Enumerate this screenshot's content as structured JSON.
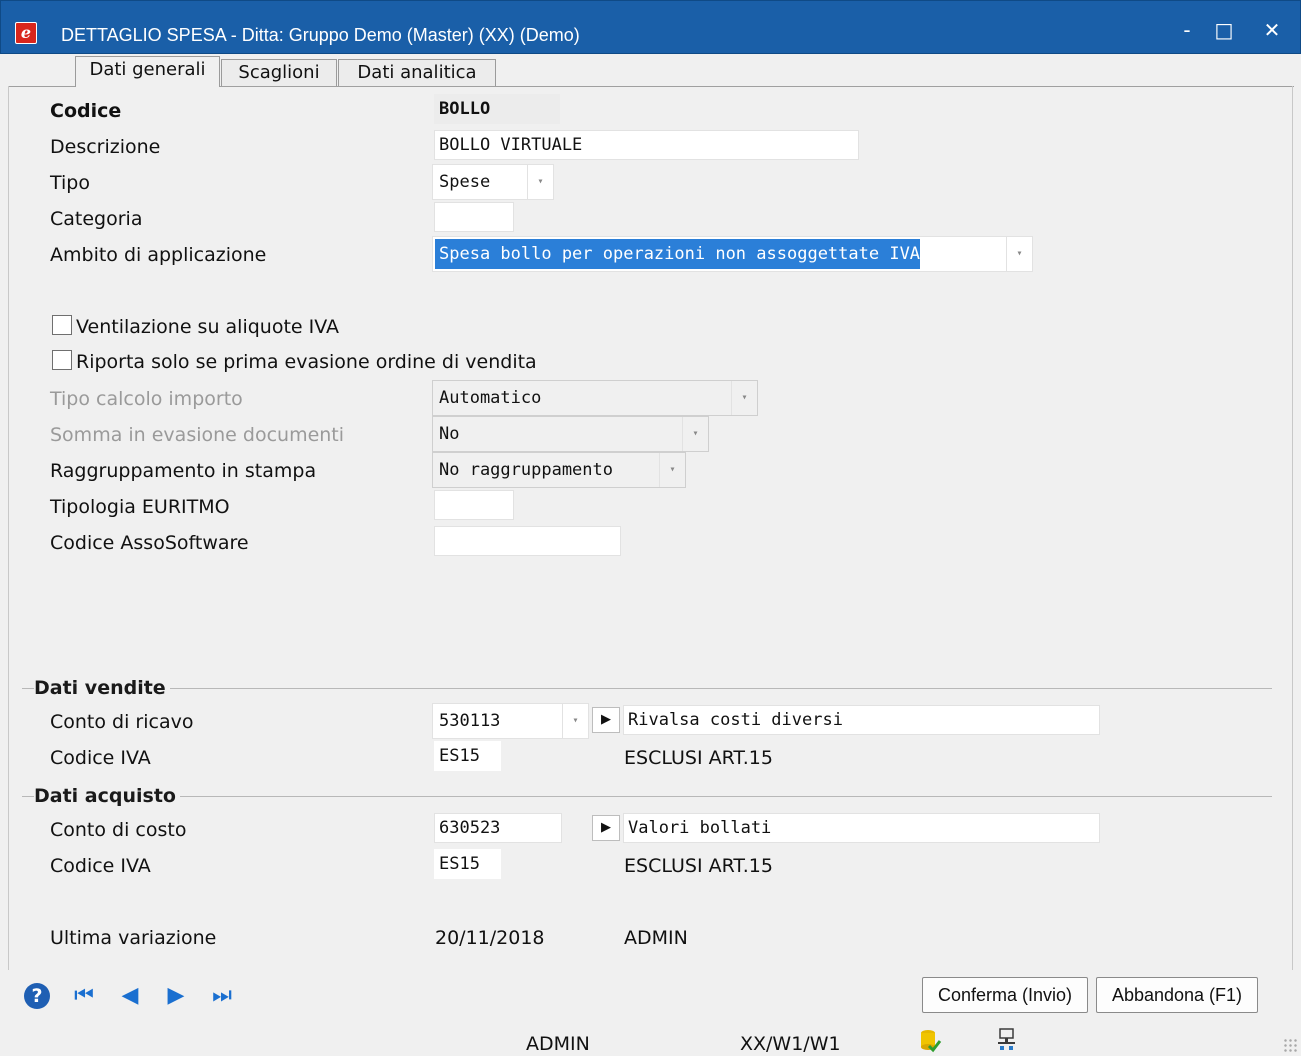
{
  "window": {
    "title": "DETTAGLIO SPESA - Ditta: Gruppo Demo (Master) (XX)  (Demo)",
    "app_icon_glyph": "e",
    "minimize": "-",
    "maximize": "□",
    "close": "✕"
  },
  "tabs": [
    {
      "label": "Dati generali",
      "active": true
    },
    {
      "label": "Scaglioni",
      "active": false
    },
    {
      "label": "Dati analitica",
      "active": false
    }
  ],
  "form": {
    "codice": {
      "label": "Codice",
      "value": "BOLLO"
    },
    "descrizione": {
      "label": "Descrizione",
      "value": "BOLLO VIRTUALE"
    },
    "tipo": {
      "label": "Tipo",
      "value": "Spese"
    },
    "categoria": {
      "label": "Categoria",
      "value": ""
    },
    "ambito": {
      "label": "Ambito di applicazione",
      "value": "Spesa bollo per operazioni non assoggettate IVA"
    },
    "ventilazione": {
      "label": "Ventilazione su aliquote IVA",
      "checked": false
    },
    "riporta": {
      "label": "Riporta solo se prima evasione ordine di vendita",
      "checked": false
    },
    "tipo_calcolo": {
      "label": "Tipo calcolo importo",
      "value": "Automatico"
    },
    "somma_evasione": {
      "label": "Somma in evasione documenti",
      "value": "No"
    },
    "raggruppamento": {
      "label": "Raggruppamento in stampa",
      "value": "No raggruppamento"
    },
    "tipologia_euritmo": {
      "label": "Tipologia EURITMO",
      "value": ""
    },
    "codice_assosoftware": {
      "label": "Codice AssoSoftware",
      "value": ""
    }
  },
  "vendite": {
    "section_title": "Dati vendite",
    "conto_label": "Conto di ricavo",
    "conto_value": "530113",
    "conto_desc": "Rivalsa costi diversi",
    "iva_label": "Codice IVA",
    "iva_value": "ES15",
    "iva_desc": "ESCLUSI ART.15"
  },
  "acquisto": {
    "section_title": "Dati acquisto",
    "conto_label": "Conto di costo",
    "conto_value": "630523",
    "conto_desc": "Valori bollati",
    "iva_label": "Codice IVA",
    "iva_value": "ES15",
    "iva_desc": "ESCLUSI ART.15"
  },
  "ultima_variazione": {
    "label": "Ultima variazione",
    "date": "20/11/2018",
    "user": "ADMIN"
  },
  "toolbar": {
    "help_glyph": "?",
    "first_glyph": "⏮",
    "prev_glyph": "◀",
    "next_glyph": "▶",
    "last_glyph": "⏭",
    "confirm_label": "Conferma (Invio)",
    "cancel_label": "Abbandona (F1)"
  },
  "statusbar": {
    "user": "ADMIN",
    "path": "XX/W1/W1"
  },
  "icons": {
    "dropdown_arrow": "▾",
    "goto_arrow": "▶"
  },
  "colors": {
    "titlebar": "#1a5fa8",
    "selection": "#2b7fd8",
    "nav_blue": "#1a6fd0"
  }
}
